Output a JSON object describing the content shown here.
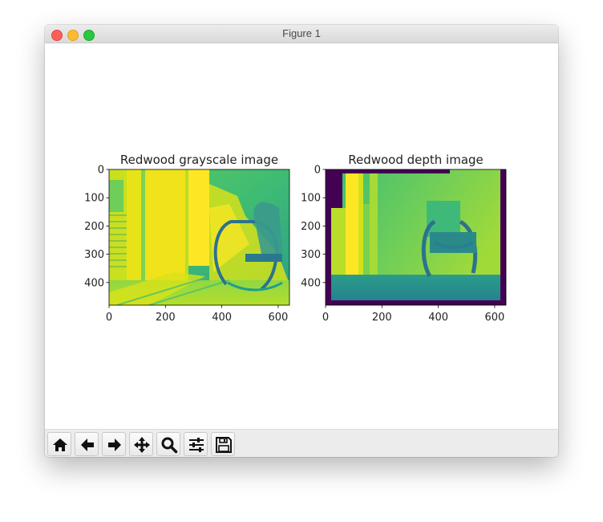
{
  "window": {
    "title": "Figure 1"
  },
  "toolbar": {
    "buttons": [
      {
        "icon": "home-icon",
        "tooltip": "Home"
      },
      {
        "icon": "back-arrow-icon",
        "tooltip": "Back"
      },
      {
        "icon": "forward-arrow-icon",
        "tooltip": "Forward"
      },
      {
        "icon": "pan-icon",
        "tooltip": "Pan"
      },
      {
        "icon": "zoom-icon",
        "tooltip": "Zoom"
      },
      {
        "icon": "sliders-icon",
        "tooltip": "Configure subplots"
      },
      {
        "icon": "save-icon",
        "tooltip": "Save"
      }
    ]
  },
  "chart_data": [
    {
      "type": "heatmap",
      "title": "Redwood grayscale image",
      "xlabel": "",
      "ylabel": "",
      "xlim": [
        0,
        640
      ],
      "ylim": [
        480,
        0
      ],
      "xticks": [
        0,
        200,
        400,
        600
      ],
      "yticks": [
        0,
        100,
        200,
        300,
        400
      ],
      "colormap": "viridis",
      "grid": false
    },
    {
      "type": "heatmap",
      "title": "Redwood depth image",
      "xlabel": "",
      "ylabel": "",
      "xlim": [
        0,
        640
      ],
      "ylim": [
        480,
        0
      ],
      "xticks": [
        0,
        200,
        400,
        600
      ],
      "yticks": [
        0,
        100,
        200,
        300,
        400
      ],
      "colormap": "viridis",
      "grid": false
    }
  ]
}
